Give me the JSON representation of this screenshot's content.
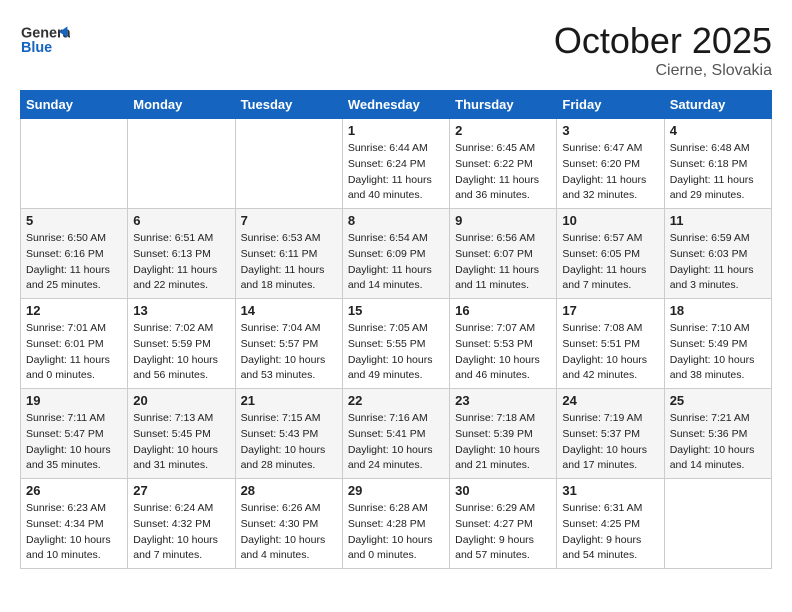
{
  "header": {
    "logo_line1": "General",
    "logo_line2": "Blue",
    "month": "October 2025",
    "location": "Cierne, Slovakia"
  },
  "weekdays": [
    "Sunday",
    "Monday",
    "Tuesday",
    "Wednesday",
    "Thursday",
    "Friday",
    "Saturday"
  ],
  "weeks": [
    [
      {
        "day": "",
        "sunrise": "",
        "sunset": "",
        "daylight": ""
      },
      {
        "day": "",
        "sunrise": "",
        "sunset": "",
        "daylight": ""
      },
      {
        "day": "",
        "sunrise": "",
        "sunset": "",
        "daylight": ""
      },
      {
        "day": "1",
        "sunrise": "Sunrise: 6:44 AM",
        "sunset": "Sunset: 6:24 PM",
        "daylight": "Daylight: 11 hours and 40 minutes."
      },
      {
        "day": "2",
        "sunrise": "Sunrise: 6:45 AM",
        "sunset": "Sunset: 6:22 PM",
        "daylight": "Daylight: 11 hours and 36 minutes."
      },
      {
        "day": "3",
        "sunrise": "Sunrise: 6:47 AM",
        "sunset": "Sunset: 6:20 PM",
        "daylight": "Daylight: 11 hours and 32 minutes."
      },
      {
        "day": "4",
        "sunrise": "Sunrise: 6:48 AM",
        "sunset": "Sunset: 6:18 PM",
        "daylight": "Daylight: 11 hours and 29 minutes."
      }
    ],
    [
      {
        "day": "5",
        "sunrise": "Sunrise: 6:50 AM",
        "sunset": "Sunset: 6:16 PM",
        "daylight": "Daylight: 11 hours and 25 minutes."
      },
      {
        "day": "6",
        "sunrise": "Sunrise: 6:51 AM",
        "sunset": "Sunset: 6:13 PM",
        "daylight": "Daylight: 11 hours and 22 minutes."
      },
      {
        "day": "7",
        "sunrise": "Sunrise: 6:53 AM",
        "sunset": "Sunset: 6:11 PM",
        "daylight": "Daylight: 11 hours and 18 minutes."
      },
      {
        "day": "8",
        "sunrise": "Sunrise: 6:54 AM",
        "sunset": "Sunset: 6:09 PM",
        "daylight": "Daylight: 11 hours and 14 minutes."
      },
      {
        "day": "9",
        "sunrise": "Sunrise: 6:56 AM",
        "sunset": "Sunset: 6:07 PM",
        "daylight": "Daylight: 11 hours and 11 minutes."
      },
      {
        "day": "10",
        "sunrise": "Sunrise: 6:57 AM",
        "sunset": "Sunset: 6:05 PM",
        "daylight": "Daylight: 11 hours and 7 minutes."
      },
      {
        "day": "11",
        "sunrise": "Sunrise: 6:59 AM",
        "sunset": "Sunset: 6:03 PM",
        "daylight": "Daylight: 11 hours and 3 minutes."
      }
    ],
    [
      {
        "day": "12",
        "sunrise": "Sunrise: 7:01 AM",
        "sunset": "Sunset: 6:01 PM",
        "daylight": "Daylight: 11 hours and 0 minutes."
      },
      {
        "day": "13",
        "sunrise": "Sunrise: 7:02 AM",
        "sunset": "Sunset: 5:59 PM",
        "daylight": "Daylight: 10 hours and 56 minutes."
      },
      {
        "day": "14",
        "sunrise": "Sunrise: 7:04 AM",
        "sunset": "Sunset: 5:57 PM",
        "daylight": "Daylight: 10 hours and 53 minutes."
      },
      {
        "day": "15",
        "sunrise": "Sunrise: 7:05 AM",
        "sunset": "Sunset: 5:55 PM",
        "daylight": "Daylight: 10 hours and 49 minutes."
      },
      {
        "day": "16",
        "sunrise": "Sunrise: 7:07 AM",
        "sunset": "Sunset: 5:53 PM",
        "daylight": "Daylight: 10 hours and 46 minutes."
      },
      {
        "day": "17",
        "sunrise": "Sunrise: 7:08 AM",
        "sunset": "Sunset: 5:51 PM",
        "daylight": "Daylight: 10 hours and 42 minutes."
      },
      {
        "day": "18",
        "sunrise": "Sunrise: 7:10 AM",
        "sunset": "Sunset: 5:49 PM",
        "daylight": "Daylight: 10 hours and 38 minutes."
      }
    ],
    [
      {
        "day": "19",
        "sunrise": "Sunrise: 7:11 AM",
        "sunset": "Sunset: 5:47 PM",
        "daylight": "Daylight: 10 hours and 35 minutes."
      },
      {
        "day": "20",
        "sunrise": "Sunrise: 7:13 AM",
        "sunset": "Sunset: 5:45 PM",
        "daylight": "Daylight: 10 hours and 31 minutes."
      },
      {
        "day": "21",
        "sunrise": "Sunrise: 7:15 AM",
        "sunset": "Sunset: 5:43 PM",
        "daylight": "Daylight: 10 hours and 28 minutes."
      },
      {
        "day": "22",
        "sunrise": "Sunrise: 7:16 AM",
        "sunset": "Sunset: 5:41 PM",
        "daylight": "Daylight: 10 hours and 24 minutes."
      },
      {
        "day": "23",
        "sunrise": "Sunrise: 7:18 AM",
        "sunset": "Sunset: 5:39 PM",
        "daylight": "Daylight: 10 hours and 21 minutes."
      },
      {
        "day": "24",
        "sunrise": "Sunrise: 7:19 AM",
        "sunset": "Sunset: 5:37 PM",
        "daylight": "Daylight: 10 hours and 17 minutes."
      },
      {
        "day": "25",
        "sunrise": "Sunrise: 7:21 AM",
        "sunset": "Sunset: 5:36 PM",
        "daylight": "Daylight: 10 hours and 14 minutes."
      }
    ],
    [
      {
        "day": "26",
        "sunrise": "Sunrise: 6:23 AM",
        "sunset": "Sunset: 4:34 PM",
        "daylight": "Daylight: 10 hours and 10 minutes."
      },
      {
        "day": "27",
        "sunrise": "Sunrise: 6:24 AM",
        "sunset": "Sunset: 4:32 PM",
        "daylight": "Daylight: 10 hours and 7 minutes."
      },
      {
        "day": "28",
        "sunrise": "Sunrise: 6:26 AM",
        "sunset": "Sunset: 4:30 PM",
        "daylight": "Daylight: 10 hours and 4 minutes."
      },
      {
        "day": "29",
        "sunrise": "Sunrise: 6:28 AM",
        "sunset": "Sunset: 4:28 PM",
        "daylight": "Daylight: 10 hours and 0 minutes."
      },
      {
        "day": "30",
        "sunrise": "Sunrise: 6:29 AM",
        "sunset": "Sunset: 4:27 PM",
        "daylight": "Daylight: 9 hours and 57 minutes."
      },
      {
        "day": "31",
        "sunrise": "Sunrise: 6:31 AM",
        "sunset": "Sunset: 4:25 PM",
        "daylight": "Daylight: 9 hours and 54 minutes."
      },
      {
        "day": "",
        "sunrise": "",
        "sunset": "",
        "daylight": ""
      }
    ]
  ]
}
